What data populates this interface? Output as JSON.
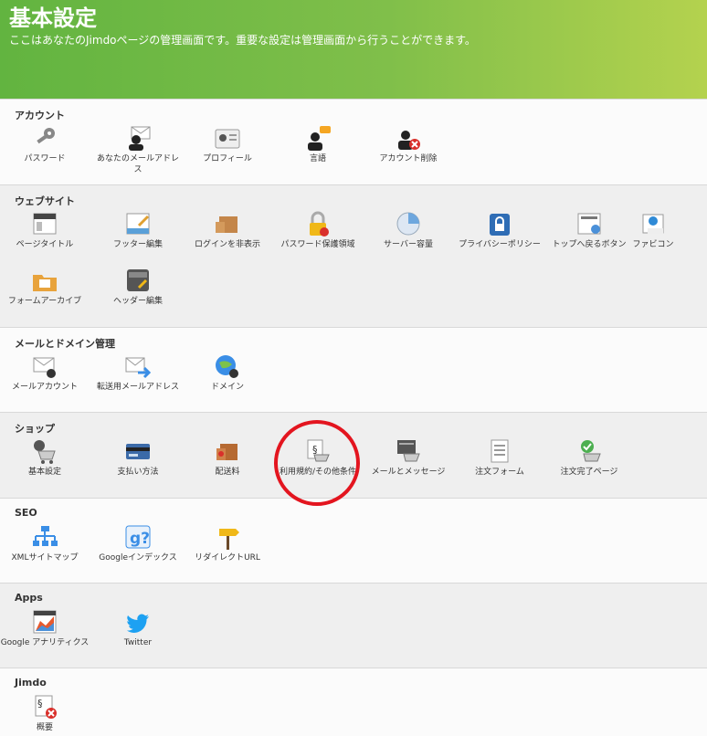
{
  "header": {
    "title": "基本設定",
    "subtitle": "ここはあなたのJimdoページの管理画面です。重要な設定は管理画面から行うことができます。"
  },
  "sections": [
    {
      "title": "アカウント",
      "items": [
        {
          "label": "パスワード",
          "icon": "key-icon"
        },
        {
          "label": "あなたのメールアドレス",
          "icon": "email-user-icon"
        },
        {
          "label": "プロフィール",
          "icon": "profile-card-icon"
        },
        {
          "label": "言語",
          "icon": "language-user-icon"
        },
        {
          "label": "アカウント削除",
          "icon": "delete-account-icon"
        }
      ]
    },
    {
      "title": "ウェブサイト",
      "items": [
        {
          "label": "ページタイトル",
          "icon": "page-title-icon"
        },
        {
          "label": "フッター編集",
          "icon": "footer-edit-icon"
        },
        {
          "label": "ログインを非表示",
          "icon": "hide-login-icon"
        },
        {
          "label": "パスワード保護領域",
          "icon": "lock-icon"
        },
        {
          "label": "サーバー容量",
          "icon": "pie-chart-icon"
        },
        {
          "label": "プライバシーポリシー",
          "icon": "privacy-lock-icon"
        },
        {
          "label": "トップへ戻るボタン",
          "icon": "back-to-top-icon"
        },
        {
          "label": "ファビコン",
          "icon": "favicon-icon"
        },
        {
          "label": "フォームアーカイブ",
          "icon": "folder-icon"
        },
        {
          "label": "ヘッダー編集",
          "icon": "head-code-icon"
        }
      ]
    },
    {
      "title": "メールとドメイン管理",
      "items": [
        {
          "label": "メールアカウント",
          "icon": "mail-settings-icon"
        },
        {
          "label": "転送用メールアドレス",
          "icon": "mail-forward-icon"
        },
        {
          "label": "ドメイン",
          "icon": "globe-settings-icon"
        }
      ]
    },
    {
      "title": "ショップ",
      "items": [
        {
          "label": "基本設定",
          "icon": "cart-settings-icon"
        },
        {
          "label": "支払い方法",
          "icon": "credit-card-icon"
        },
        {
          "label": "配送料",
          "icon": "shipping-box-icon"
        },
        {
          "label": "利用規約/その他条件",
          "icon": "terms-cart-icon"
        },
        {
          "label": "メールとメッセージ",
          "icon": "cart-mail-icon"
        },
        {
          "label": "注文フォーム",
          "icon": "order-form-icon"
        },
        {
          "label": "注文完了ページ",
          "icon": "order-complete-icon"
        }
      ]
    },
    {
      "title": "SEO",
      "items": [
        {
          "label": "XMLサイトマップ",
          "icon": "sitemap-icon"
        },
        {
          "label": "Googleインデックス",
          "icon": "google-index-icon"
        },
        {
          "label": "リダイレクトURL",
          "icon": "signpost-icon"
        }
      ]
    },
    {
      "title": "Apps",
      "items": [
        {
          "label": "Google アナリティクス",
          "icon": "analytics-icon"
        },
        {
          "label": "Twitter",
          "icon": "twitter-icon"
        }
      ]
    },
    {
      "title": "Jimdo",
      "items": [
        {
          "label": "概要",
          "icon": "cancel-contract-icon"
        }
      ]
    }
  ],
  "colors": {
    "header_start": "#62b440",
    "header_end": "#b4d24e",
    "highlight_circle": "#e3151f"
  }
}
